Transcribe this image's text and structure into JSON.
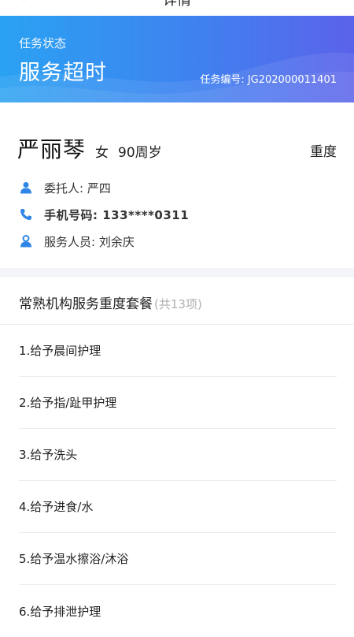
{
  "header": {
    "title": "详情",
    "back_icon": "chevron-left-icon"
  },
  "banner": {
    "status_label": "任务状态",
    "status_value": "服务超时",
    "task_number": "任务编号: JG202000011401",
    "gradient_start": "#2aa2f2",
    "gradient_end": "#5b62ea"
  },
  "person": {
    "name": "严丽琴",
    "gender": "女",
    "age": "90周岁",
    "care_level": "重度",
    "details": [
      {
        "icon": "person-icon",
        "label": "委托人: 严四"
      },
      {
        "icon": "phone-icon",
        "label": "手机号码: 133****0311"
      },
      {
        "icon": "staff-icon",
        "label": "服务人员: 刘余庆"
      }
    ],
    "icon_color": "#2f86e6"
  },
  "package": {
    "name": "常熟机构服务重度套餐",
    "count": "(共13项)"
  },
  "services": [
    "1.给予晨间护理",
    "2.给予指/趾甲护理",
    "3.给予洗头",
    "4.给予进食/水",
    "5.给予温水擦浴/沐浴",
    "6.给予排泄护理"
  ]
}
